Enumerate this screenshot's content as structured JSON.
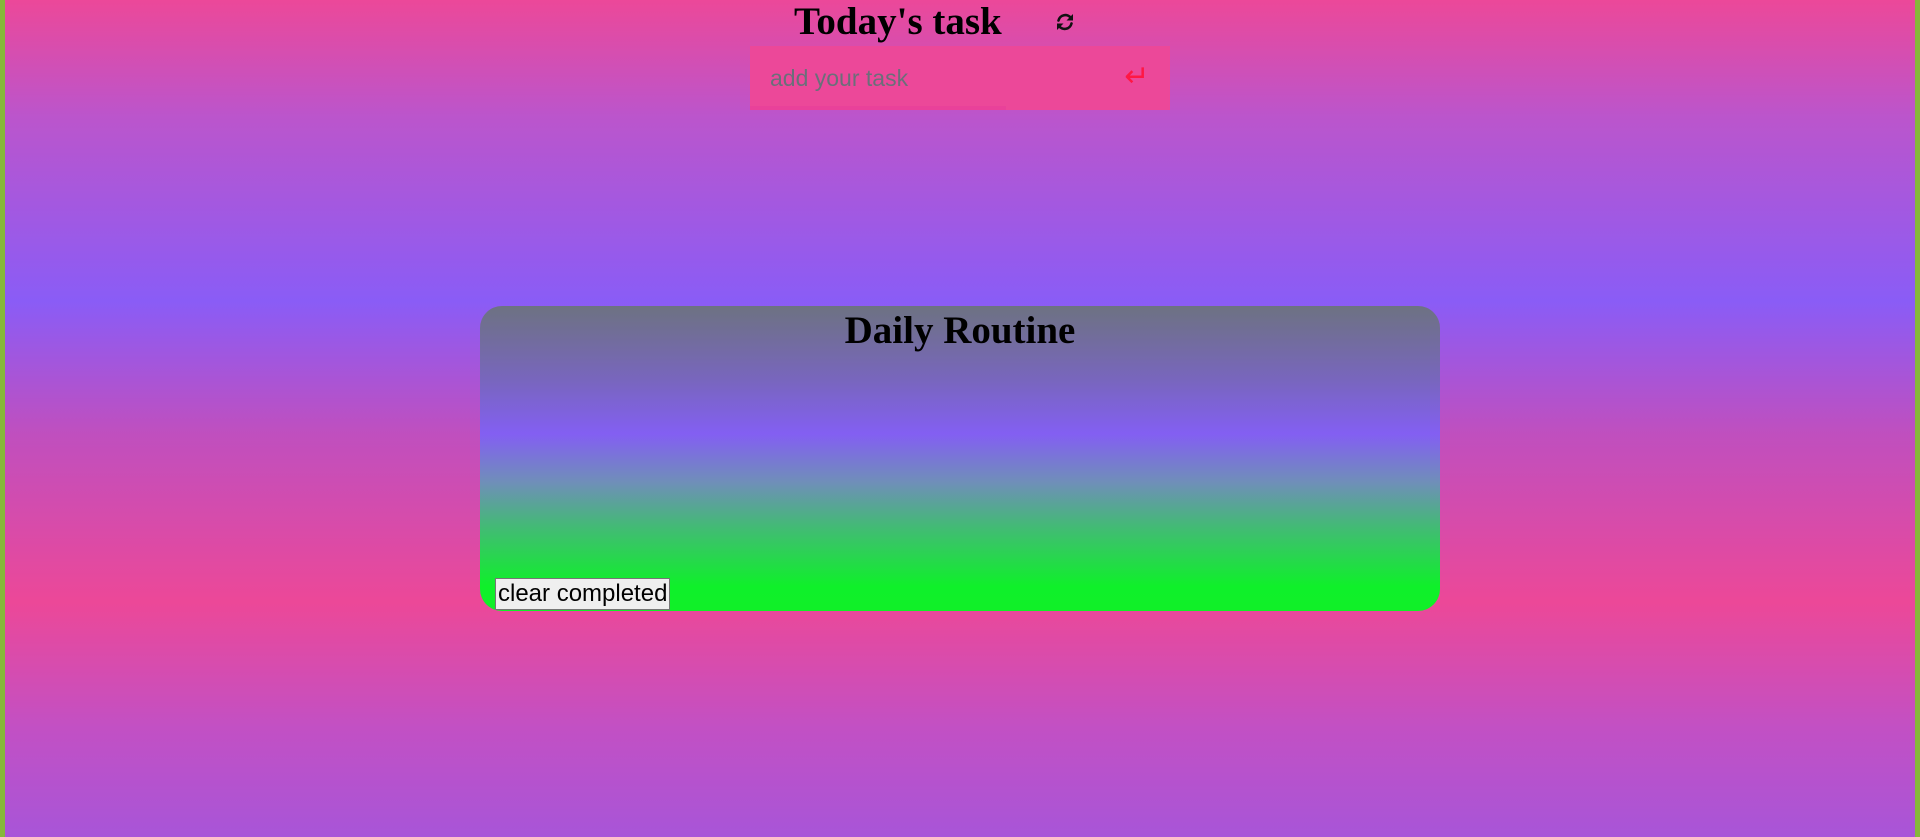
{
  "header": {
    "title": "Today's task",
    "refresh_icon": "refresh-icon"
  },
  "task_form": {
    "input_value": "",
    "placeholder": "add your task",
    "submit_icon": "enter-return-icon",
    "submit_glyph": "↵"
  },
  "routine": {
    "title": "Daily Routine",
    "tasks": [],
    "clear_label": "clear completed"
  },
  "colors": {
    "input_background": "#ec4899",
    "submit_icon": "#ff1744",
    "panel_bottom": "#10f028",
    "panel_middle": "#835ff2"
  }
}
